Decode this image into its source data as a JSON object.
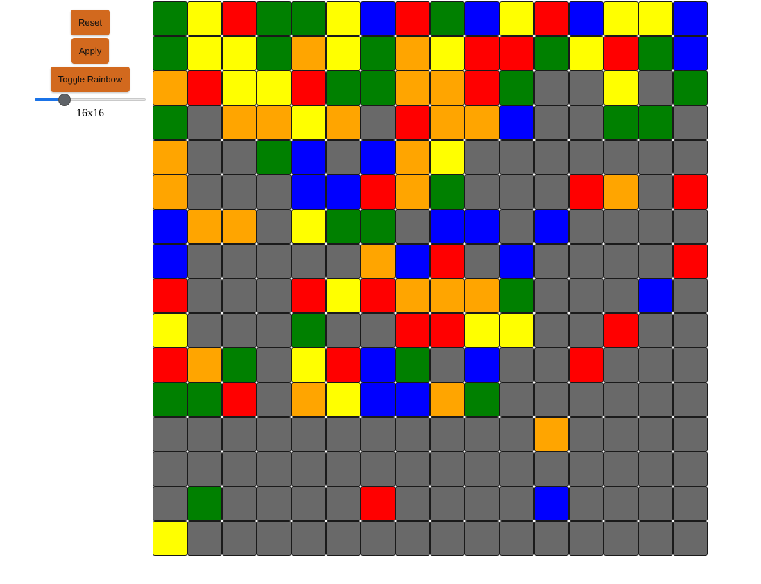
{
  "controls": {
    "reset_label": "Reset",
    "apply_label": "Apply",
    "toggle_rainbow_label": "Toggle Rainbow",
    "grid_size_label": "16x16",
    "slider": {
      "min": 1,
      "max": 64,
      "value": 16
    }
  },
  "colors": {
    "G": "#008000",
    "Y": "#ffff00",
    "R": "#ff0000",
    "B": "#0000ff",
    "O": "#ffa500",
    "x": "#696969",
    "button": "#d2691e",
    "slider_accent": "#1a73e8"
  },
  "grid": {
    "rows": [
      "GYRGGYBRGBYRBYYB",
      "GYYGOYGOYRRGYRGB",
      "ORYYRGGOORGxxYxG",
      "GxOOYOxROOBxxGGx",
      "OxxGBxBOYxxxxxxx",
      "OxxxBBROGxxxROxR",
      "BOOxYGGxBBxBxxxx",
      "BxxxxxOBRxBxxxxR",
      "RxxxRYROOOGxxxBx",
      "YxxxGxxRRYYxxRxx",
      "ROGxYRBGxBxxRxxx",
      "GGRxOYBBOGxxxxxx",
      "xxxxxxxxxxxOxxxx",
      "xxxxxxxxxxxxxxxx",
      "xGxxxxRxxxxBxxxx",
      "Yxxxxxxxxxxxxxxx"
    ]
  }
}
